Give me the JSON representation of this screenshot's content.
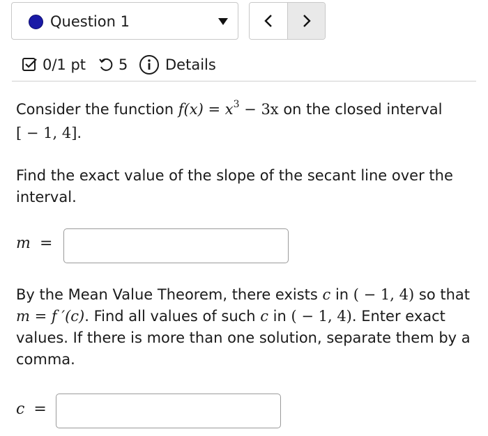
{
  "question_selector": {
    "label": "Question 1"
  },
  "nav": {
    "prev": "<",
    "next": ">"
  },
  "meta": {
    "score": "0/1 pt",
    "attempts": "5",
    "details": "Details"
  },
  "problem": {
    "p1_text1": "Consider the function ",
    "p1_func_lhs": "f(x)",
    "p1_eq": " = ",
    "p1_base": "x",
    "p1_exp": "3",
    "p1_rest": " − 3x",
    "p1_text2": " on the closed interval",
    "p1_interval": "[ − 1, 4]",
    "p1_end": ".",
    "p2_line1": "Find the exact value of the slope of the secant line over the",
    "p2_line2": "interval.",
    "m_label": "m",
    "m_eq": "=",
    "p3_a": "By the Mean Value Theorem, there exists ",
    "p3_c": "c",
    "p3_b": " in ",
    "p3_int": "( − 1, 4)",
    "p3_c2": " so that",
    "p3_m": "m",
    "p3_eq": " = ",
    "p3_fp": "f ′(c)",
    "p3_d": ". Find all values of such ",
    "p3_c3": "c",
    "p3_e": " in ",
    "p3_int2": "( − 1, 4)",
    "p3_f": ". Enter exact",
    "p3_line3": "values. If there is more than one solution, separate them by a",
    "p3_line4": "comma.",
    "c_label": "c",
    "c_eq": "="
  },
  "answers": {
    "m_value": "",
    "c_value": ""
  },
  "colors": {
    "question_dot": "#1a1aa6",
    "next_bg": "#e9e9e9"
  },
  "icons": [
    "checkbox-icon",
    "retry-icon",
    "info-icon",
    "chevron-left-icon",
    "chevron-right-icon",
    "dropdown-caret-icon"
  ]
}
